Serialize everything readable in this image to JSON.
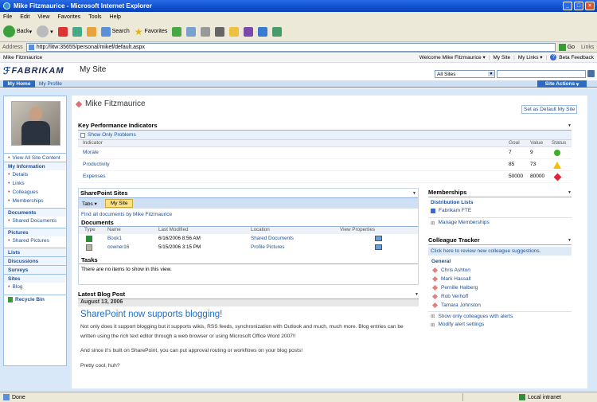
{
  "window": {
    "title": "Mike Fitzmaurice - Microsoft Internet Explorer"
  },
  "menu": [
    "File",
    "Edit",
    "View",
    "Favorites",
    "Tools",
    "Help"
  ],
  "toolbar": {
    "back": "Back",
    "search": "Search",
    "favorites": "Favorites"
  },
  "address": {
    "label": "Address",
    "url": "http://litw:35655/personal/mikef/default.aspx",
    "go": "Go",
    "links": "Links"
  },
  "topbar": {
    "user": "Mike Fitzmaurice",
    "welcome": "Welcome Mike Fitzmaurice",
    "mysite": "My Site",
    "mylinks": "My Links",
    "feedback": "Beta Feedback"
  },
  "header": {
    "logo": "FABRIKAM",
    "site_title": "My Site",
    "scope": "All Sites",
    "site_actions": "Site Actions"
  },
  "tabs": [
    "My Home",
    "My Profile"
  ],
  "nav": {
    "view_all": "View All Site Content",
    "sections": [
      {
        "title": "My Information",
        "items": [
          "Details",
          "Links",
          "Colleagues",
          "Memberships"
        ]
      },
      {
        "title": "Documents",
        "items": [
          "Shared Documents"
        ]
      },
      {
        "title": "Pictures",
        "items": [
          "Shared Pictures"
        ]
      },
      {
        "title": "Lists",
        "items": []
      },
      {
        "title": "Discussions",
        "items": []
      },
      {
        "title": "Surveys",
        "items": []
      },
      {
        "title": "Sites",
        "items": [
          "Blog"
        ]
      }
    ],
    "recycle": "Recycle Bin"
  },
  "page": {
    "name": "Mike Fitzmaurice",
    "set_default": "Set as Default My Site"
  },
  "kpi": {
    "title": "Key Performance Indicators",
    "show_problems": "Show Only Problems",
    "columns": [
      "Indicator",
      "Goal",
      "Value",
      "Status"
    ],
    "rows": [
      {
        "name": "Morale",
        "goal": "7",
        "value": "9",
        "status": "green-circle-icon",
        "color": "#3fae2a"
      },
      {
        "name": "Productivity",
        "goal": "85",
        "value": "73",
        "status": "yellow-triangle-icon",
        "color": "#f2c200"
      },
      {
        "name": "Expenses",
        "goal": "50000",
        "value": "80000",
        "status": "red-diamond-icon",
        "color": "#d9263e"
      }
    ]
  },
  "sp_sites": {
    "title": "SharePoint Sites",
    "tab1": "Tabs",
    "tab2": "My Site",
    "find_all": "Find all documents by Mike Fitzmaurice",
    "docs_title": "Documents",
    "columns": [
      "Type",
      "Name",
      "Last Modified",
      "Location",
      "View Properties"
    ],
    "docs": [
      {
        "name": "Book1",
        "modified": "6/16/2006 8:56 AM",
        "location": "Shared Documents"
      },
      {
        "name": "cowner16",
        "modified": "5/15/2006 3:15 PM",
        "location": "Profile Pictures"
      }
    ],
    "tasks_title": "Tasks",
    "tasks_empty": "There are no items to show in this view."
  },
  "memberships": {
    "title": "Memberships",
    "dist_title": "Distribution Lists",
    "items": [
      "Fabrikam FTE"
    ],
    "manage": "Manage Memberships"
  },
  "colleague": {
    "title": "Colleague Tracker",
    "review": "Click here to review new colleague suggestions.",
    "group": "General",
    "people": [
      "Chris Ashton",
      "Mark Hassall",
      "Pernille Halberg",
      "Rob Verhoff",
      "Tamara Johnston"
    ],
    "show_alerts": "Show only colleagues with alerts",
    "modify": "Modify alert settings"
  },
  "blog": {
    "title": "Latest Blog Post",
    "date": "August 13, 2006",
    "headline": "SharePoint now supports blogging!",
    "p1": "Not only does it support blogging but it supports wikis, RSS feeds, synchronization with Outlook and much, much more.  Blog entries can be written using the rich text editor through a web browser or using Microsoft Office Word 2007!!",
    "p2": "And since it's built on SharePoint, you can put approval routing or workflows on your blog posts!",
    "p3": "Pretty cool, huh?"
  },
  "status": {
    "left": "Done",
    "zone": "Local intranet"
  }
}
